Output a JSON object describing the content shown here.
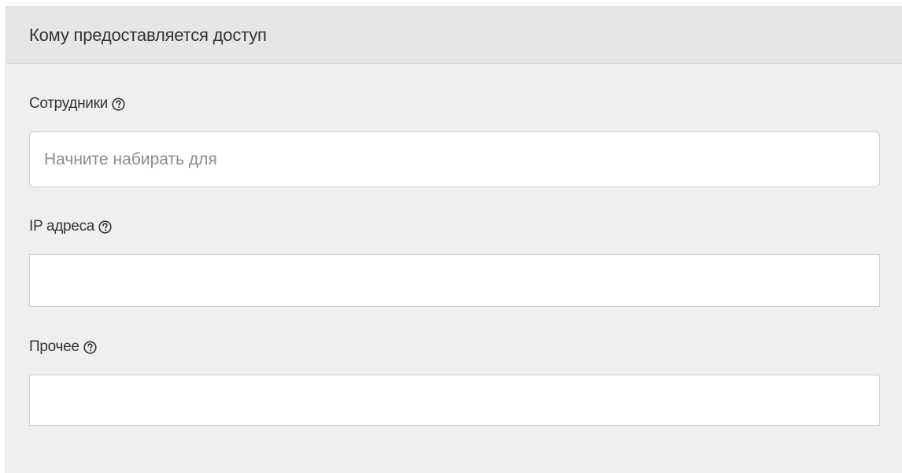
{
  "panel": {
    "title": "Кому предоставляется доступ"
  },
  "fields": [
    {
      "label": "Сотрудники",
      "placeholder": "Начните набирать для",
      "value": "",
      "help_icon": "question-circle-icon"
    },
    {
      "label": "IP адреса",
      "placeholder": "",
      "value": "",
      "help_icon": "question-circle-icon"
    },
    {
      "label": "Прочее",
      "placeholder": "",
      "value": "",
      "help_icon": "question-circle-icon"
    }
  ],
  "colors": {
    "panel_background": "#efefef",
    "header_background": "#e6e6e6",
    "input_border": "#cfcfcf",
    "text": "#333333",
    "placeholder": "#8c8c8c"
  }
}
